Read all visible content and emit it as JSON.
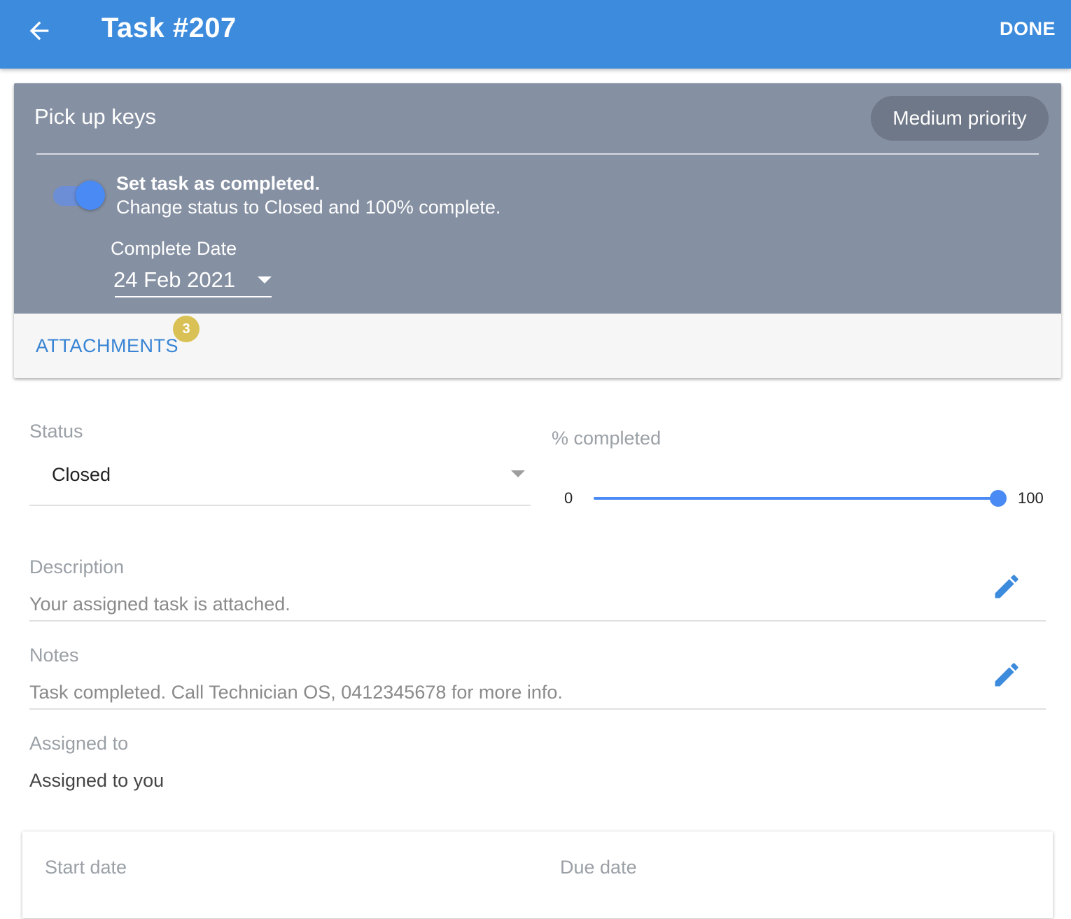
{
  "appbar": {
    "title": "Task #207",
    "done_label": "DONE"
  },
  "task": {
    "name": "Pick up keys",
    "priority": "Medium priority",
    "complete_toggle": {
      "on": true,
      "title": "Set task as completed.",
      "subtitle": "Change status to Closed and 100% complete."
    },
    "complete_date": {
      "label": "Complete Date",
      "value": "24 Feb 2021"
    },
    "attachments": {
      "label": "ATTACHMENTS",
      "count": "3"
    }
  },
  "status": {
    "label": "Status",
    "value": "Closed"
  },
  "percent": {
    "label": "% completed",
    "min": "0",
    "max": "100",
    "value": 100
  },
  "description": {
    "label": "Description",
    "value": "Your assigned task is attached."
  },
  "notes": {
    "label": "Notes",
    "value": "Task completed. Call Technician OS, 0412345678 for more info."
  },
  "assigned": {
    "label": "Assigned to",
    "value": "Assigned to you"
  },
  "dates": {
    "start_label": "Start date",
    "due_label": "Due date"
  },
  "colors": {
    "primary": "#3d8bdc",
    "card_header": "#8590a2",
    "accent": "#4a8af4",
    "badge": "#d9c155"
  },
  "icons": {
    "back": "arrow-left-icon",
    "edit": "pencil-icon",
    "dropdown": "triangle-down-icon"
  }
}
